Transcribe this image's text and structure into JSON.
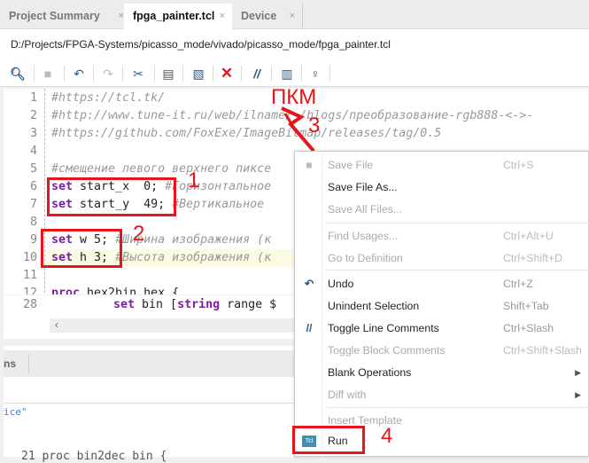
{
  "tabs": [
    {
      "label": "Project Summary",
      "active": false
    },
    {
      "label": "fpga_painter.tcl",
      "active": true
    },
    {
      "label": "Device",
      "active": false
    }
  ],
  "close_glyph": "×",
  "file_path": "D:/Projects/FPGA-Systems/picasso_mode/vivado/picasso_mode/fpga_painter.tcl",
  "toolbar": [
    "search-icon",
    "save-icon",
    "undo-icon",
    "redo-icon",
    "cut-icon",
    "copy-icon",
    "paste-icon",
    "delete-icon",
    "comment-icon",
    "column-icon",
    "lightbulb-icon"
  ],
  "editor": {
    "lines": [
      {
        "n": "1",
        "code": "#https://tcl.tk/"
      },
      {
        "n": "2",
        "code": "#http://www.tune-it.ru/web/ilname/-/blogs/преобразование-rgb888-<->-"
      },
      {
        "n": "3",
        "code": "#https://github.com/FoxExe/ImageBitmap/releases/tag/0.5"
      },
      {
        "n": "4",
        "code": ""
      },
      {
        "n": "5",
        "code": "#смещение левого верхнего пиксе"
      },
      {
        "n": "6",
        "kw": "set",
        "code": " start_x  0; ",
        "comment": "#Горизонтальное"
      },
      {
        "n": "7",
        "kw": "set",
        "code": " start_y  49; ",
        "comment": "#Вертикальное"
      },
      {
        "n": "8",
        "code": ""
      },
      {
        "n": "9",
        "kw": "set",
        "code": " w 5; ",
        "comment": "#Ширина изображения (к"
      },
      {
        "n": "10",
        "kw": "set",
        "code": " h 3; ",
        "comment": "#Высота изображения (к"
      },
      {
        "n": "11",
        "code": ""
      },
      {
        "n": "12",
        "kw": "proc",
        "code": " hex2bin hex {"
      }
    ],
    "pane2_line": {
      "n": "28",
      "kw": "set",
      "code": " bin [",
      "kw2": "string",
      "code2": " range $"
    },
    "bottom_tab": "ns",
    "bottom_text": "ice\"",
    "bottom_line": "21   proc bin2dec bin {"
  },
  "annotations": {
    "pkm": "ПКМ",
    "n1": "1",
    "n2": "2",
    "n3": "3",
    "n4": "4"
  },
  "context_menu": [
    {
      "label": "Save File",
      "shortcut": "Ctrl+S",
      "disabled": true,
      "icon": "save-icon"
    },
    {
      "label": "Save File As...",
      "shortcut": "",
      "disabled": false
    },
    {
      "label": "Save All Files...",
      "shortcut": "",
      "disabled": true
    },
    {
      "label": "Find Usages...",
      "shortcut": "Ctrl+Alt+U",
      "disabled": true
    },
    {
      "label": "Go to Definition",
      "shortcut": "Ctrl+Shift+D",
      "disabled": true
    },
    {
      "label": "Undo",
      "shortcut": "Ctrl+Z",
      "disabled": false,
      "icon": "undo-icon"
    },
    {
      "label": "Unindent Selection",
      "shortcut": "Shift+Tab",
      "disabled": false
    },
    {
      "label": "Toggle Line Comments",
      "shortcut": "Ctrl+Slash",
      "disabled": false,
      "icon": "comment-icon"
    },
    {
      "label": "Toggle Block Comments",
      "shortcut": "Ctrl+Shift+Slash",
      "disabled": true
    },
    {
      "label": "Blank Operations",
      "shortcut": "",
      "disabled": false,
      "submenu": true
    },
    {
      "label": "Diff with",
      "shortcut": "",
      "disabled": true,
      "submenu": true
    },
    {
      "label": "Insert Template",
      "shortcut": "",
      "disabled": true
    },
    {
      "label": "Run",
      "shortcut": "",
      "disabled": false,
      "icon": "tcl-icon",
      "icon_text": "Tcl"
    }
  ],
  "colors": {
    "annotation_red": "#e8141b",
    "keyword": "#7a1fa2",
    "menu_icon_blue": "#2d5a8a"
  }
}
